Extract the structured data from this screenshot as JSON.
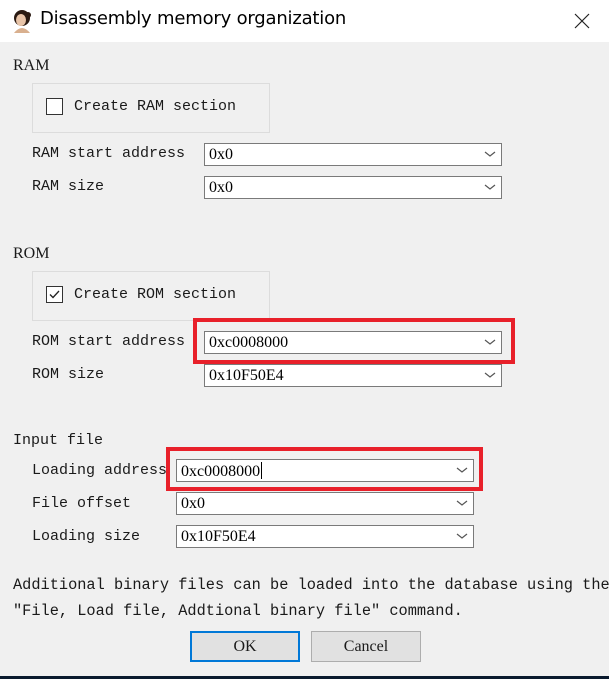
{
  "window": {
    "title": "Disassembly memory organization",
    "icon": "app-portrait-icon",
    "close_icon": "close-icon"
  },
  "ram": {
    "group_label": "RAM",
    "create_section_label": "Create RAM section",
    "create_section_checked": false,
    "start_address_label": "RAM start address",
    "start_address_value": "0x0",
    "size_label": "RAM size",
    "size_value": "0x0"
  },
  "rom": {
    "group_label": "ROM",
    "create_section_label": "Create ROM section",
    "create_section_checked": true,
    "start_address_label": "ROM start address",
    "start_address_value": "0xc0008000",
    "size_label": "ROM size",
    "size_value": "0x10F50E4"
  },
  "input_file": {
    "group_label": "Input file",
    "loading_address_label": "Loading address",
    "loading_address_value": "0xc0008000",
    "file_offset_label": "File offset",
    "file_offset_value": "0x0",
    "loading_size_label": "Loading size",
    "loading_size_value": "0x10F50E4"
  },
  "info": {
    "line1": "Additional binary files can be loaded into the database using the",
    "line2": "\"File, Load file, Addtional binary file\" command."
  },
  "buttons": {
    "ok": "OK",
    "cancel": "Cancel"
  },
  "annotations": {
    "highlight_color": "#e8202a"
  }
}
